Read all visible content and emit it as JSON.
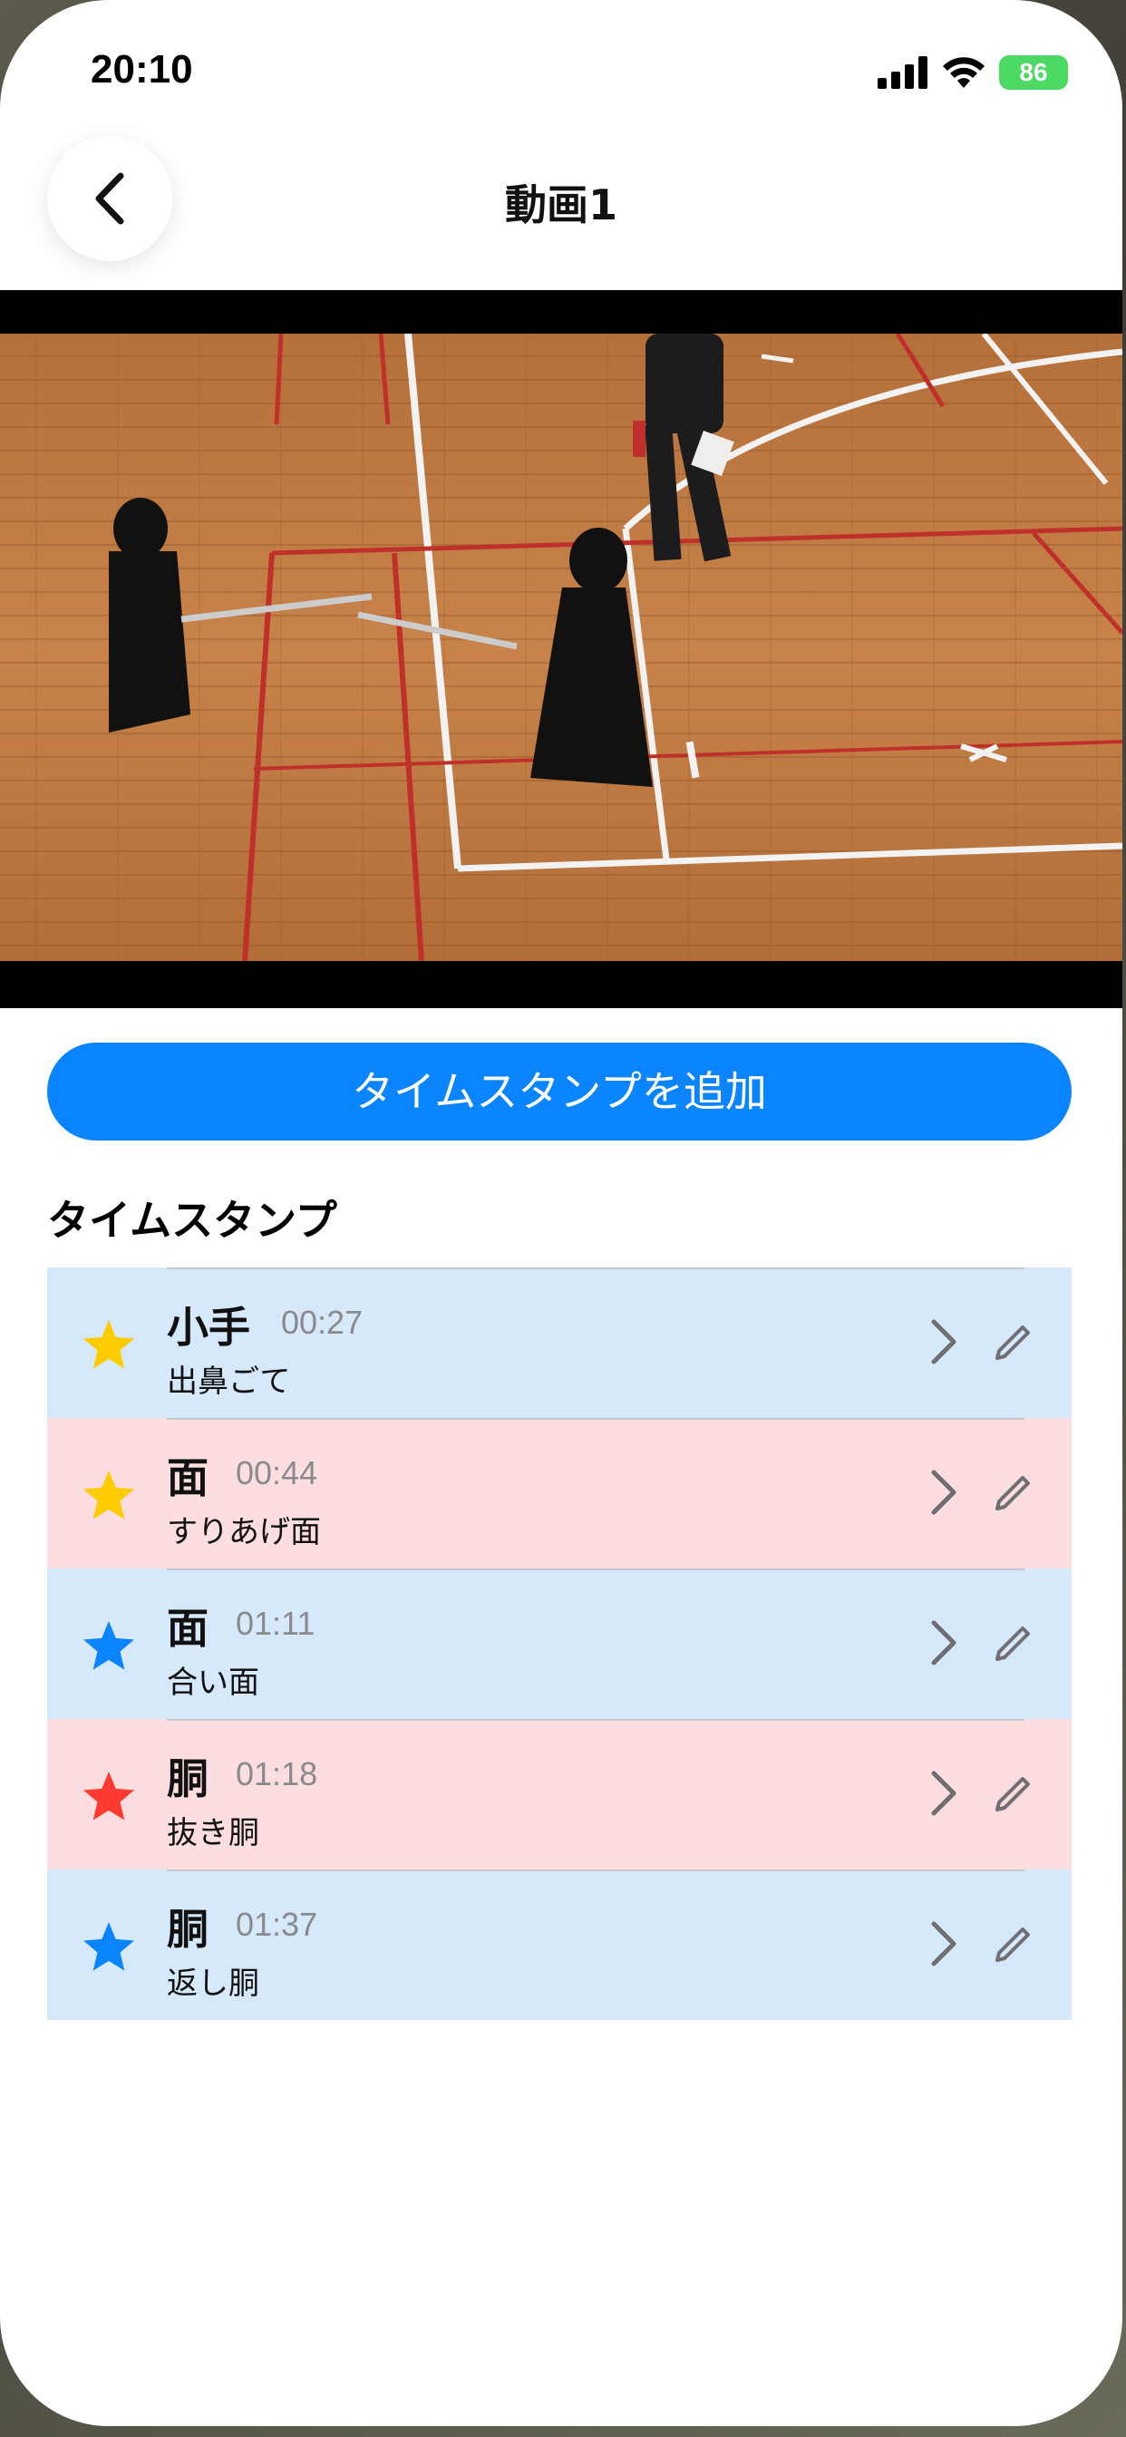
{
  "status": {
    "time": "20:10",
    "battery": "86"
  },
  "nav": {
    "title": "動画1",
    "back_icon": "chevron-left-icon"
  },
  "actions": {
    "add_timestamp": "タイムスタンプを追加"
  },
  "section": {
    "title": "タイムスタンプ"
  },
  "colors": {
    "accent": "#0a84ff",
    "blue_row": "#d6e9fb",
    "pink_row": "#fcdde0",
    "star_yellow": "#ffcc00",
    "star_blue": "#0a84ff",
    "star_red": "#ff3b30"
  },
  "timestamps": [
    {
      "name": "小手",
      "time": "00:27",
      "sub": "出鼻ごて",
      "row": "blue",
      "star": "#ffcc00"
    },
    {
      "name": "面",
      "time": "00:44",
      "sub": "すりあげ面",
      "row": "pink",
      "star": "#ffcc00"
    },
    {
      "name": "面",
      "time": "01:11",
      "sub": "合い面",
      "row": "blue",
      "star": "#0a84ff"
    },
    {
      "name": "胴",
      "time": "01:18",
      "sub": "抜き胴",
      "row": "pink",
      "star": "#ff3b30"
    },
    {
      "name": "胴",
      "time": "01:37",
      "sub": "返し胴",
      "row": "blue",
      "star": "#0a84ff"
    }
  ]
}
